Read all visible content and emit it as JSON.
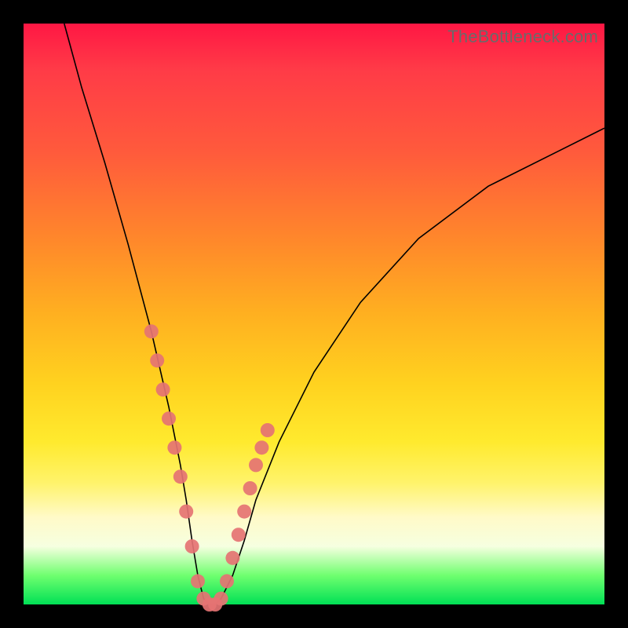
{
  "watermark": "TheBottleneck.com",
  "chart_data": {
    "type": "line",
    "title": "",
    "xlabel": "",
    "ylabel": "",
    "xlim": [
      0,
      100
    ],
    "ylim": [
      0,
      100
    ],
    "series": [
      {
        "name": "curve",
        "x": [
          7,
          10,
          14,
          18,
          22,
          25,
          27,
          28,
          29,
          30,
          31,
          32,
          33,
          34,
          35,
          36,
          38,
          40,
          44,
          50,
          58,
          68,
          80,
          92,
          100
        ],
        "y": [
          100,
          89,
          76,
          62,
          47,
          34,
          24,
          18,
          11,
          5,
          1,
          0,
          0,
          1,
          3,
          5,
          11,
          18,
          28,
          40,
          52,
          63,
          72,
          78,
          82
        ]
      }
    ],
    "markers": {
      "name": "highlighted-points",
      "x": [
        22,
        23,
        24,
        25,
        26,
        27,
        28,
        29,
        30,
        31,
        32,
        33,
        34,
        35,
        36,
        37,
        38,
        39,
        40,
        41,
        42
      ],
      "y": [
        47,
        42,
        37,
        32,
        27,
        22,
        16,
        10,
        4,
        1,
        0,
        0,
        1,
        4,
        8,
        12,
        16,
        20,
        24,
        27,
        30
      ]
    }
  },
  "colors": {
    "curve": "#000000",
    "marker": "#e57373"
  }
}
